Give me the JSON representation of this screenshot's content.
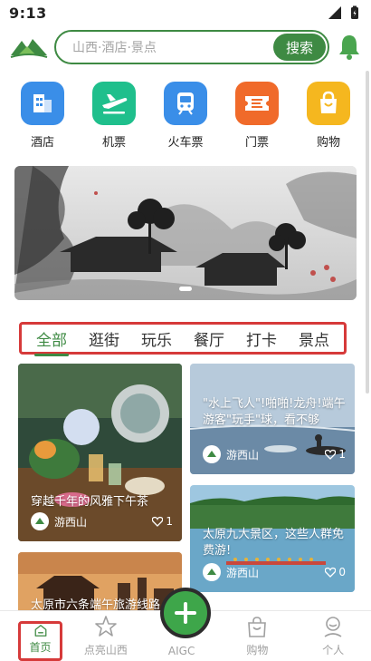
{
  "status_bar": {
    "time": "9:13"
  },
  "search": {
    "placeholder": "山西·酒店·景点",
    "button": "搜索"
  },
  "categories": [
    {
      "label": "酒店",
      "color": "#3a8ee8"
    },
    {
      "label": "机票",
      "color": "#1fbf8c"
    },
    {
      "label": "火车票",
      "color": "#3a8ee8"
    },
    {
      "label": "门票",
      "color": "#f06a2a"
    },
    {
      "label": "购物",
      "color": "#f5b71f"
    }
  ],
  "tabs": [
    "全部",
    "逛街",
    "玩乐",
    "餐厅",
    "打卡",
    "景点"
  ],
  "feed": [
    {
      "title": "穿越千年的风雅下午茶",
      "author": "游西山",
      "likes": "1"
    },
    {
      "title": "\"水上飞人\"!啪啪!龙舟!端午游客\"玩手\"球，看不够",
      "author": "游西山",
      "likes": "1"
    },
    {
      "title": "太原九大景区，这些人群免费游!",
      "author": "游西山",
      "likes": "0"
    },
    {
      "title": "太原市六条端午旅游线路",
      "author": "",
      "likes": ""
    }
  ],
  "bottom_nav": {
    "home": "首页",
    "explore": "点亮山西",
    "aigc": "AIGC",
    "shop": "购物",
    "me": "个人"
  },
  "colors": {
    "brand": "#3e8a43",
    "highlight_box": "#d63a3a"
  }
}
